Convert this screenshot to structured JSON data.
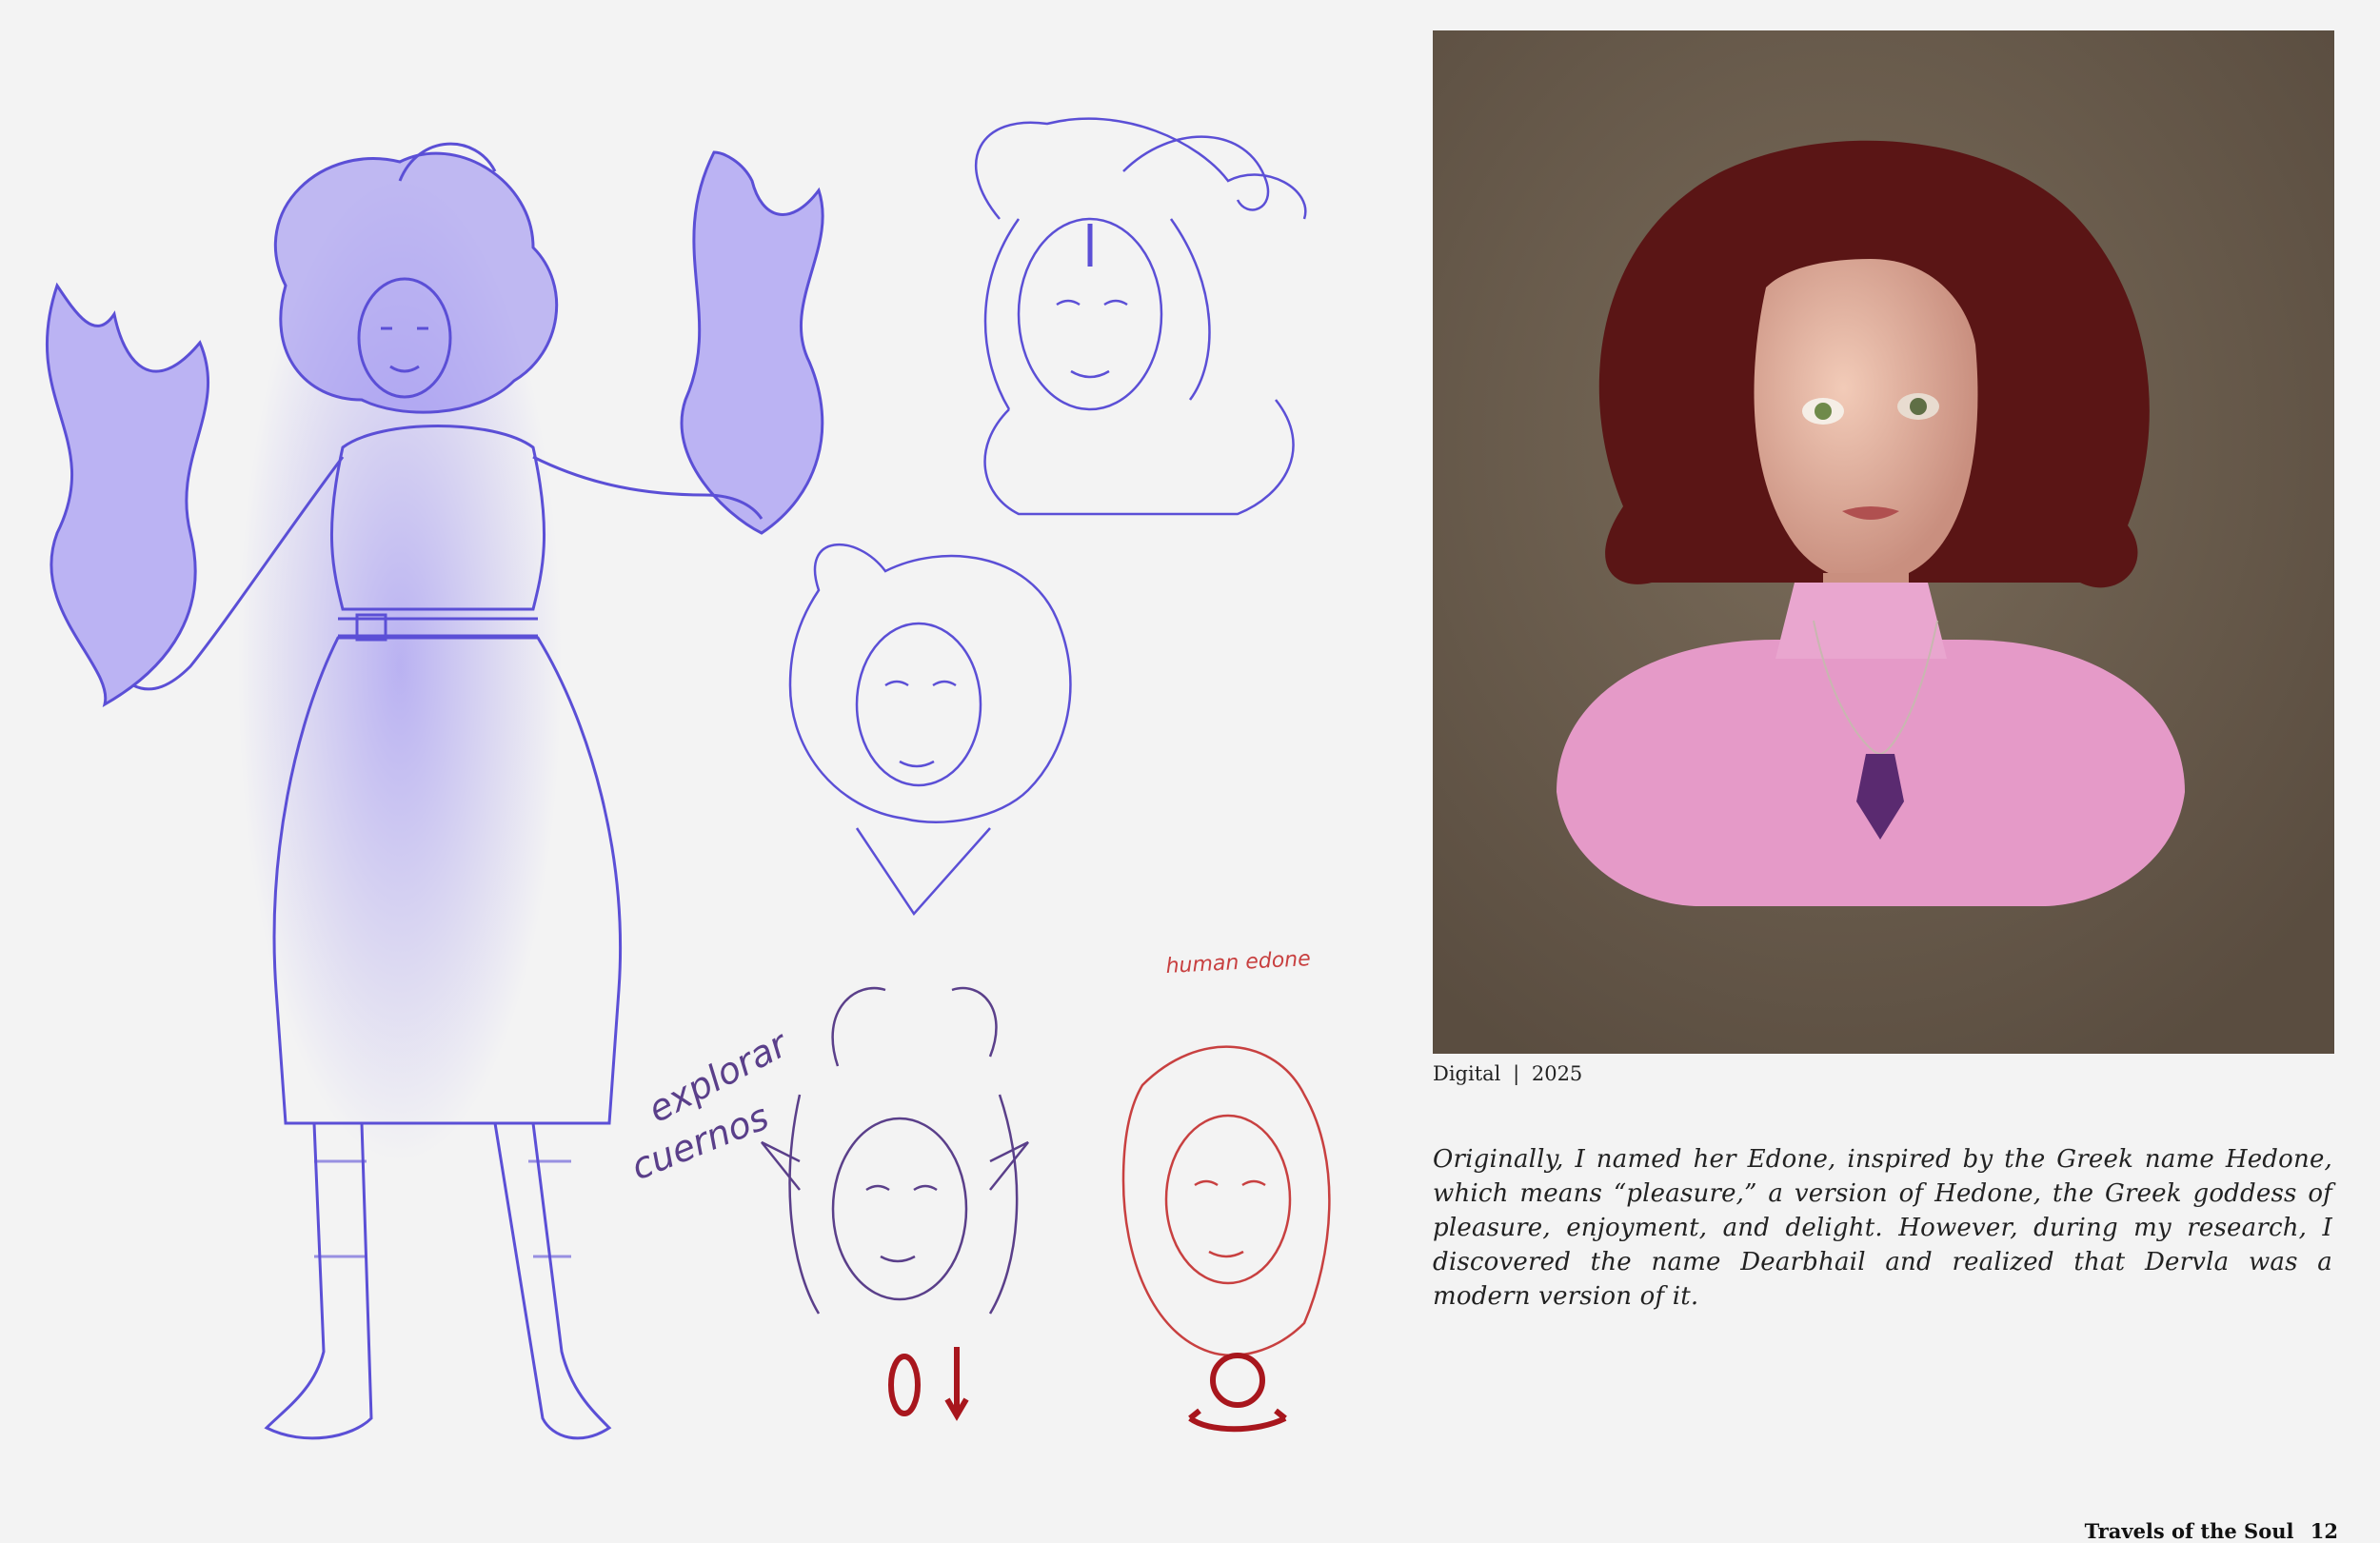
{
  "caption": {
    "medium": "Digital",
    "separator": "|",
    "year": "2025"
  },
  "body_text": "Originally, I named her Edone, inspired by the Greek name Hedone, which means “pleasure,” a version of Hedone, the Greek goddess of pleasure, enjoyment, and delight. However, during my research, I discovered the name Dearbhail and realized that Dervla was a modern version of it.",
  "sketch_notes": {
    "explore_horns_line1": "explorar",
    "explore_horns_line2": "cuernos",
    "human_label": "human edone"
  },
  "footer": {
    "book_title": "Travels of the Soul",
    "page_number": "12"
  },
  "colors": {
    "page_bg": "#f3f3f3",
    "sketch_violet": "#6a5ad8",
    "sketch_red": "#b22222",
    "painting_bg": "#6d5f4f",
    "hair": "#5a1515",
    "blouse": "#e59ac8"
  }
}
